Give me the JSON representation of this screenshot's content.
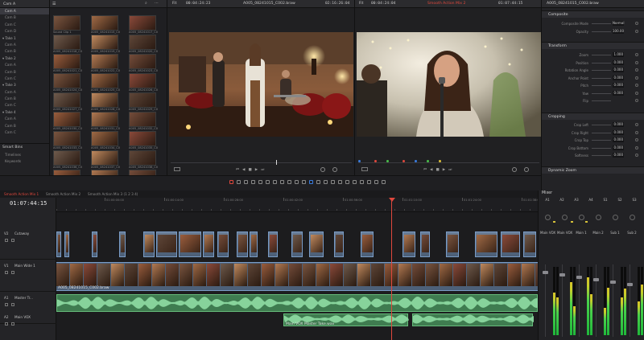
{
  "bins": {
    "header": "Cam A",
    "items": [
      {
        "label": "Cam A",
        "selected": true
      },
      {
        "label": "Cam B"
      },
      {
        "label": "Cam C"
      },
      {
        "label": "Cam D"
      },
      {
        "label": "Take 1",
        "group": true
      },
      {
        "label": "Cam A"
      },
      {
        "label": "Cam B"
      },
      {
        "label": "Take 2",
        "group": true
      },
      {
        "label": "Cam A"
      },
      {
        "label": "Cam B"
      },
      {
        "label": "Cam C"
      },
      {
        "label": "Take 3",
        "group": true
      },
      {
        "label": "Cam A"
      },
      {
        "label": "Cam B"
      },
      {
        "label": "Cam C"
      },
      {
        "label": "Take 4",
        "group": true
      },
      {
        "label": "Cam A"
      },
      {
        "label": "Cam B"
      },
      {
        "label": "Cam C"
      }
    ],
    "smart_bins_title": "Smart Bins",
    "smart_bins": [
      "Timelines",
      "Keywords"
    ]
  },
  "media_pool": {
    "captions": [
      "Sound Clip 1",
      "A005_08241015_C001",
      "A005_08241017_C002",
      "A005_08241018_C003",
      "A005_08241019_C004",
      "A005_08241020_C005",
      "A005_08241021_C006",
      "A005_08241022_C007",
      "A005_08241023_C008",
      "A005_08241024_C009",
      "A005_08241025_C010",
      "A005_08241026_C011",
      "A005_08241027_C012",
      "A005_08241028_C013",
      "A005_08241029_C014",
      "A005_08241030_C015",
      "A005_08241031_C016",
      "A005_08241032_C017",
      "A005_08241033_C018",
      "A005_08241034_C019",
      "A005_08241035_C020",
      "A005_08241036_C021",
      "A005_08241037_C022",
      "A005_08241038_C023",
      "A005_08241039_C024",
      "A005_08241040_C025",
      "A005_08241041_C026"
    ]
  },
  "source_viewer": {
    "zoom": "Fit",
    "timecode_in": "00:04:24:23",
    "clip_name": "A005_08241015_C002.braw",
    "timecode_out": "02:16:26:04"
  },
  "timeline_viewer": {
    "zoom": "Fit",
    "timecode_in": "00:04:24:04",
    "timeline_name": "Smooth Action Mix 2",
    "timecode_out": "01:07:44:15"
  },
  "inspector": {
    "clip_name": "A005_08241015_C002.braw",
    "sections": {
      "composite": "Composite",
      "transform": "Transform",
      "cropping": "Cropping",
      "dynamic_zoom": "Dynamic Zoom"
    },
    "composite_rows": [
      {
        "label": "Composite Mode",
        "value": "Normal"
      },
      {
        "label": "Opacity",
        "value": "100.00"
      }
    ],
    "transform_rows": [
      {
        "label": "Zoom",
        "value": "1.000"
      },
      {
        "label": "Position",
        "value": "0.000"
      },
      {
        "label": "Rotation Angle",
        "value": "0.000"
      },
      {
        "label": "Anchor Point",
        "value": "0.000"
      },
      {
        "label": "Pitch",
        "value": "0.000"
      },
      {
        "label": "Yaw",
        "value": "0.000"
      },
      {
        "label": "Flip",
        "value": ""
      }
    ],
    "cropping_rows": [
      {
        "label": "Crop Left",
        "value": "0.000"
      },
      {
        "label": "Crop Right",
        "value": "0.000"
      },
      {
        "label": "Crop Top",
        "value": "0.000"
      },
      {
        "label": "Crop Bottom",
        "value": "0.000"
      },
      {
        "label": "Softness",
        "value": "0.000"
      }
    ]
  },
  "timeline": {
    "tabs": [
      "Smooth Action Mix 1",
      "Smooth Action Mix 2",
      "Smooth Action Mix 3 (1 2 3 4)"
    ],
    "timecode": "01:07:44:15",
    "ruler_labels": [
      "01:00:00:00",
      "01:00:14:00",
      "01:00:28:00",
      "01:00:42:00",
      "01:00:56:00",
      "01:01:10:00",
      "01:01:24:00",
      "01:01:38:00"
    ],
    "tracks": [
      {
        "num": "V2",
        "name": "Cutaway"
      },
      {
        "num": "V1",
        "name": "Main Wide 1"
      },
      {
        "num": "A1",
        "name": "Master Tr..."
      },
      {
        "num": "A2",
        "name": "Main VOX"
      }
    ],
    "v1_clip_label": "A005_08241015_C002.braw",
    "a2_clip_label": "Main VOX Master Take.wav"
  },
  "mixer": {
    "title": "Mixer",
    "channels": [
      "A1",
      "A2",
      "A3",
      "A4",
      "S1",
      "S2",
      "S3"
    ],
    "strip_labels": [
      "Main VOX",
      "Main VOX",
      "Main 1",
      "Main 2",
      "Sub 1",
      "Sub 2"
    ],
    "levels": [
      0.62,
      0.55,
      0.78,
      0.42,
      0.85,
      0.6,
      0.4,
      0.7,
      0.55,
      0.68,
      0.5,
      0.74
    ],
    "master_label": "Master 1"
  },
  "colors": {
    "accent": "#e0483d",
    "clip_blue": "#5a6e88",
    "audio_green": "#4fae63",
    "meter_green": "#1fb83a"
  }
}
